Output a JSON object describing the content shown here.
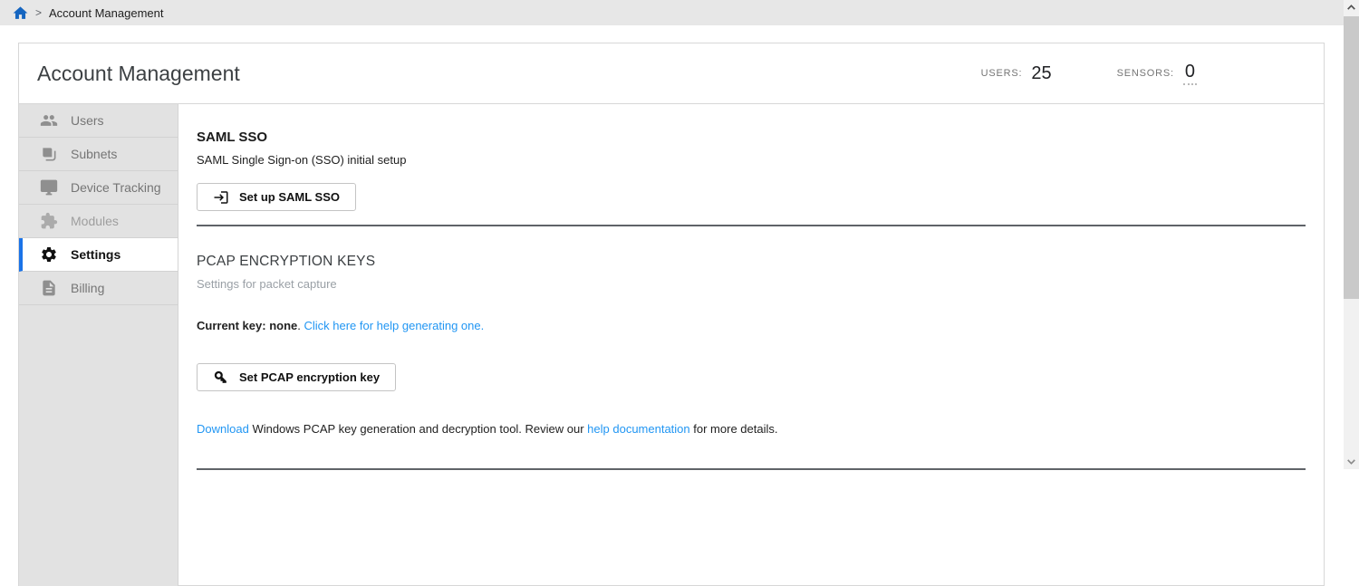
{
  "breadcrumb": {
    "separator": ">",
    "current": "Account Management"
  },
  "header": {
    "title": "Account Management",
    "stats": [
      {
        "label": "USERS:",
        "value": "25"
      },
      {
        "label": "SENSORS:",
        "value": "0"
      }
    ]
  },
  "sidebar": {
    "items": [
      {
        "label": "Users",
        "icon": "users-icon",
        "active": false
      },
      {
        "label": "Subnets",
        "icon": "subnets-icon",
        "active": false
      },
      {
        "label": "Device Tracking",
        "icon": "device-tracking-icon",
        "active": false
      },
      {
        "label": "Modules",
        "icon": "modules-icon",
        "active": false
      },
      {
        "label": "Settings",
        "icon": "settings-icon",
        "active": true
      },
      {
        "label": "Billing",
        "icon": "billing-icon",
        "active": false
      }
    ]
  },
  "main": {
    "saml": {
      "title": "SAML SSO",
      "subtitle": "SAML Single Sign-on (SSO) initial setup",
      "button_label": "Set up SAML SSO"
    },
    "pcap": {
      "title": "PCAP ENCRYPTION KEYS",
      "subtitle": "Settings for packet capture",
      "current_key_bold": "Current key: none",
      "current_key_period": ". ",
      "help_link": "Click here for help generating one.",
      "button_label": "Set PCAP encryption key",
      "download_link": "Download",
      "download_mid": " Windows PCAP key generation and decryption tool. Review our ",
      "docs_link": "help documentation",
      "download_tail": " for more details."
    }
  },
  "colors": {
    "accent_blue": "#1a73e8",
    "link_blue": "#2196f3",
    "home_icon_blue": "#1565c0",
    "sidebar_bg": "#e2e2e2",
    "breadcrumb_bg": "#e7e7e7",
    "divider_dark": "#5f6368"
  }
}
